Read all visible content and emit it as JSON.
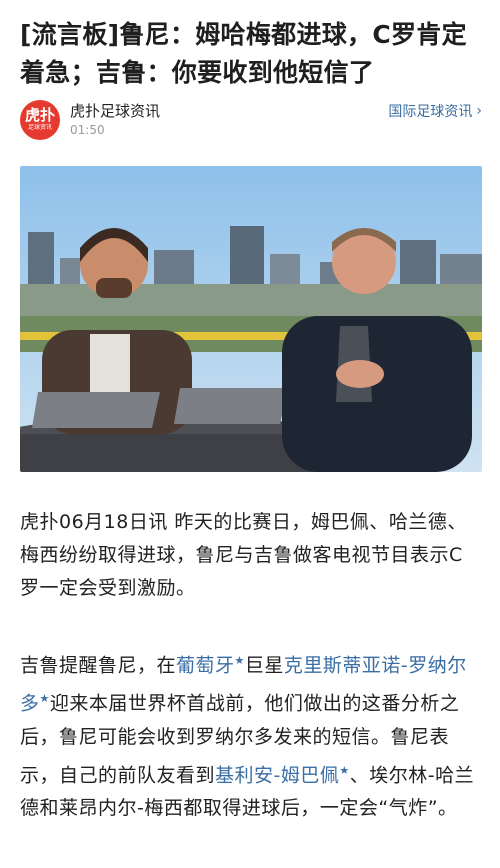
{
  "article": {
    "title": "[流言板]鲁尼：姆哈梅都进球，C罗肯定着急；吉鲁：你要收到他短信了"
  },
  "source": {
    "avatar_glyph": "虎扑",
    "avatar_sub": "足球资讯",
    "name": "虎扑足球资讯",
    "time": "01:50",
    "category_link": "国际足球资讯",
    "chevron": "›"
  },
  "body": {
    "p1": "虎扑06月18日讯 昨天的比赛日，姆巴佩、哈兰德、梅西纷纷取得进球，鲁尼与吉鲁做客电视节目表示C罗一定会受到激励。",
    "p2": {
      "s1": "吉鲁提醒鲁尼，在",
      "kw1": "葡萄牙",
      "s2": "巨星",
      "kw2": "克里斯蒂亚诺-罗纳尔多",
      "s3": "迎来本届世界杯首战前，他们做出的这番分析之后，鲁尼可能会收到罗纳尔多发来的短信。鲁尼表示，自己的前队友看到",
      "kw3": "基利安-姆巴佩",
      "s4": "、埃尔林-哈兰德和莱昂内尔-梅西都取得进球后，一定会“气炸”。",
      "star": "★"
    }
  },
  "colors": {
    "link": "#3a6ea5",
    "brand": "#e53a2f"
  }
}
